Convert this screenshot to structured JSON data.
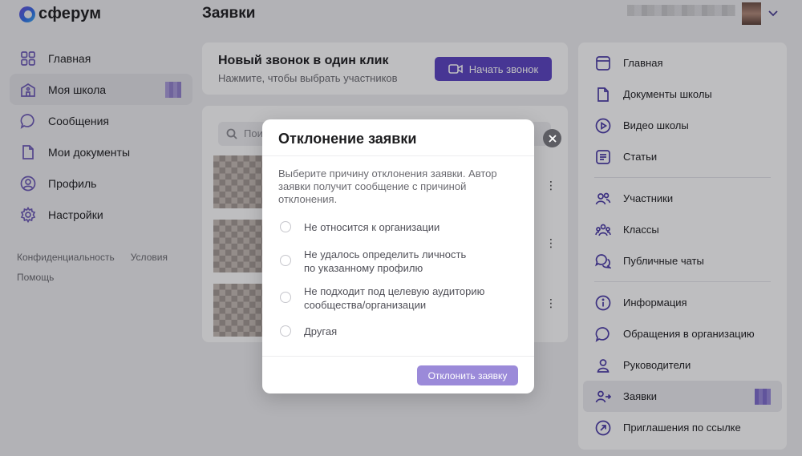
{
  "header": {
    "logo_text": "сферум",
    "page_title": "Заявки"
  },
  "left_nav": {
    "items": [
      {
        "label": "Главная",
        "icon": "grid-icon"
      },
      {
        "label": "Моя школа",
        "icon": "school-icon"
      },
      {
        "label": "Сообщения",
        "icon": "chat-bubble-icon"
      },
      {
        "label": "Мои документы",
        "icon": "document-icon"
      },
      {
        "label": "Профиль",
        "icon": "user-circle-icon"
      },
      {
        "label": "Настройки",
        "icon": "gear-icon"
      }
    ],
    "footer": {
      "privacy": "Конфиденциальность",
      "terms": "Условия",
      "help": "Помощь"
    }
  },
  "call_card": {
    "title": "Новый звонок в один клик",
    "subtitle": "Нажмите, чтобы выбрать участников",
    "button_label": "Начать звонок"
  },
  "list_card": {
    "search_placeholder": "Пои"
  },
  "right_nav": {
    "group1": [
      {
        "label": "Главная",
        "icon": "window-icon"
      },
      {
        "label": "Документы школы",
        "icon": "document-icon"
      },
      {
        "label": "Видео школы",
        "icon": "play-circle-icon"
      },
      {
        "label": "Статьи",
        "icon": "article-icon"
      }
    ],
    "group2": [
      {
        "label": "Участники",
        "icon": "users-icon"
      },
      {
        "label": "Классы",
        "icon": "group-icon"
      },
      {
        "label": "Публичные чаты",
        "icon": "chats-icon"
      }
    ],
    "group3": [
      {
        "label": "Информация",
        "icon": "info-icon"
      },
      {
        "label": "Обращения в организацию",
        "icon": "message-icon"
      },
      {
        "label": "Руководители",
        "icon": "person-icon"
      },
      {
        "label": "Заявки",
        "icon": "user-arrow-icon"
      },
      {
        "label": "Приглашения по ссылке",
        "icon": "link-arrow-icon"
      }
    ]
  },
  "modal": {
    "title": "Отклонение заявки",
    "description": "Выберите причину отклонения заявки. Автор заявки получит сообщение с причиной отклонения.",
    "options": [
      {
        "line1": "Не относится к организации",
        "line2": ""
      },
      {
        "line1": "Не удалось определить личность",
        "line2": "по указанному профилю"
      },
      {
        "line1": "Не подходит под целевую аудиторию",
        "line2": "сообщества/организации"
      },
      {
        "line1": "Другая",
        "line2": ""
      }
    ],
    "reject_label": "Отклонить заявку"
  }
}
